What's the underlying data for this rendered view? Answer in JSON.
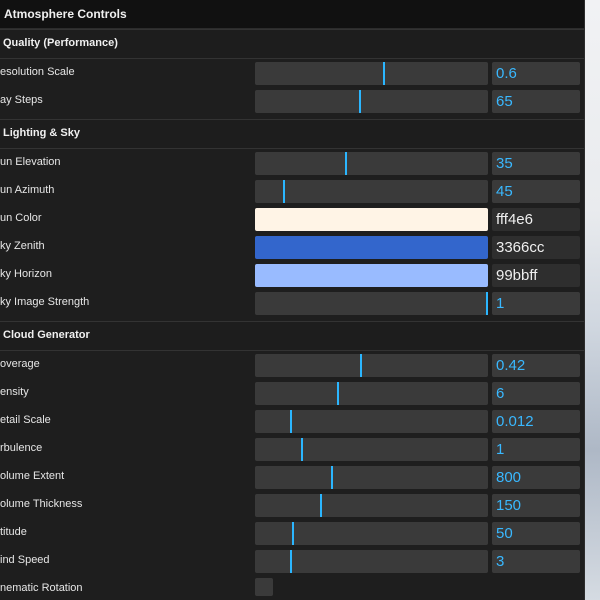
{
  "panel": {
    "title": "Atmosphere Controls"
  },
  "sections": {
    "quality": "Quality (Performance)",
    "lighting": "Lighting & Sky",
    "cloud": "Cloud Generator"
  },
  "quality_rows": [
    {
      "label": "esolution Scale",
      "value": "0.6",
      "fill": 0.555
    },
    {
      "label": "ay Steps",
      "value": "65",
      "fill": 0.45
    }
  ],
  "lighting_rows": [
    {
      "label": "un Elevation",
      "value": "35",
      "fill": 0.39
    },
    {
      "label": "un Azimuth",
      "value": "45",
      "fill": 0.125
    }
  ],
  "lighting_colors": [
    {
      "label": "un Color",
      "hex": "fff4e6",
      "color": "#fff4e6"
    },
    {
      "label": "ky Zenith",
      "hex": "3366cc",
      "color": "#3366cc"
    },
    {
      "label": "ky Horizon",
      "hex": "99bbff",
      "color": "#99bbff"
    }
  ],
  "lighting_strength": {
    "label": "ky Image Strength",
    "value": "1",
    "fill": 1.0
  },
  "cloud_rows": [
    {
      "label": "overage",
      "value": "0.42",
      "fill": 0.455
    },
    {
      "label": "ensity",
      "value": "6",
      "fill": 0.355
    },
    {
      "label": "etail Scale",
      "value": "0.012",
      "fill": 0.155
    },
    {
      "label": "rbulence",
      "value": "1",
      "fill": 0.2
    },
    {
      "label": "olume Extent",
      "value": "800",
      "fill": 0.33
    },
    {
      "label": "olume Thickness",
      "value": "150",
      "fill": 0.285
    },
    {
      "label": "titude",
      "value": "50",
      "fill": 0.165
    },
    {
      "label": "ind Speed",
      "value": "3",
      "fill": 0.155
    }
  ],
  "cinematic": {
    "label": "nematic Rotation"
  }
}
